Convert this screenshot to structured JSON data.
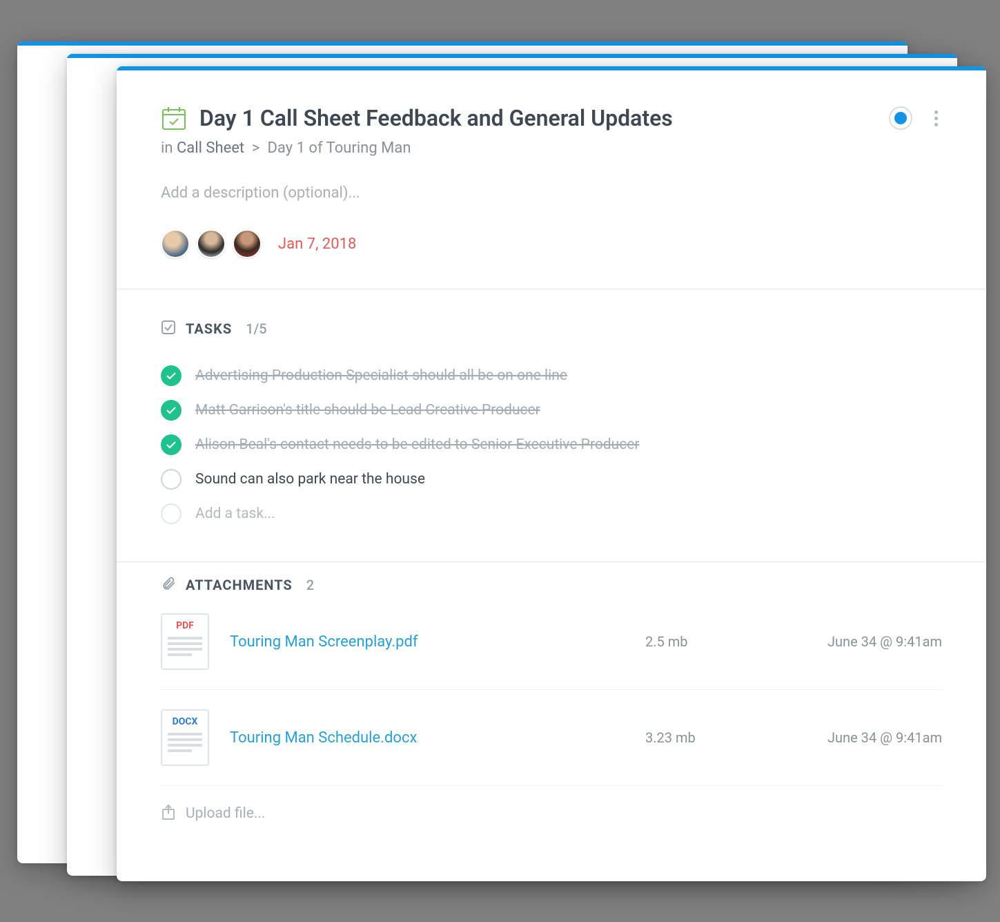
{
  "header": {
    "title": "Day 1 Call Sheet Feedback and General Updates",
    "breadcrumb_prefix": "in",
    "breadcrumb_parent": "Call Sheet",
    "breadcrumb_separator": ">",
    "breadcrumb_current": "Day 1 of Touring Man",
    "description_placeholder": "Add a description (optional)...",
    "date": "Jan 7, 2018",
    "avatars": [
      {
        "bg": "radial-gradient(circle at 40% 35%, #e8c9a8 30%, #4a6a88 70%)"
      },
      {
        "bg": "radial-gradient(circle at 50% 30%, #d8b89a 25%, #2b2b2b 60%, #e8e8e8 100%)"
      },
      {
        "bg": "radial-gradient(circle at 50% 30%, #c99878 25%, #3a2820 55%, #b03838 100%)"
      }
    ]
  },
  "tasks": {
    "label": "TASKS",
    "count": "1/5",
    "add_placeholder": "Add a task...",
    "items": [
      {
        "done": true,
        "text": "Advertising Production Specialist should all be on one line"
      },
      {
        "done": true,
        "text": "Matt Garrison's title should be Lead Creative Producer"
      },
      {
        "done": true,
        "text": "Alison Beal's contact needs to be edited to Senior Executive Producer"
      },
      {
        "done": false,
        "text": "Sound can also park near the house"
      }
    ]
  },
  "attachments": {
    "label": "ATTACHMENTS",
    "count": "2",
    "upload_placeholder": "Upload file...",
    "items": [
      {
        "ext": "PDF",
        "ext_class": "pdf",
        "name": "Touring Man Screenplay.pdf",
        "size": "2.5 mb",
        "date": "June 34 @ 9:41am"
      },
      {
        "ext": "DOCX",
        "ext_class": "docx",
        "name": "Touring Man Schedule.docx",
        "size": "3.23 mb",
        "date": "June 34 @ 9:41am"
      }
    ]
  }
}
